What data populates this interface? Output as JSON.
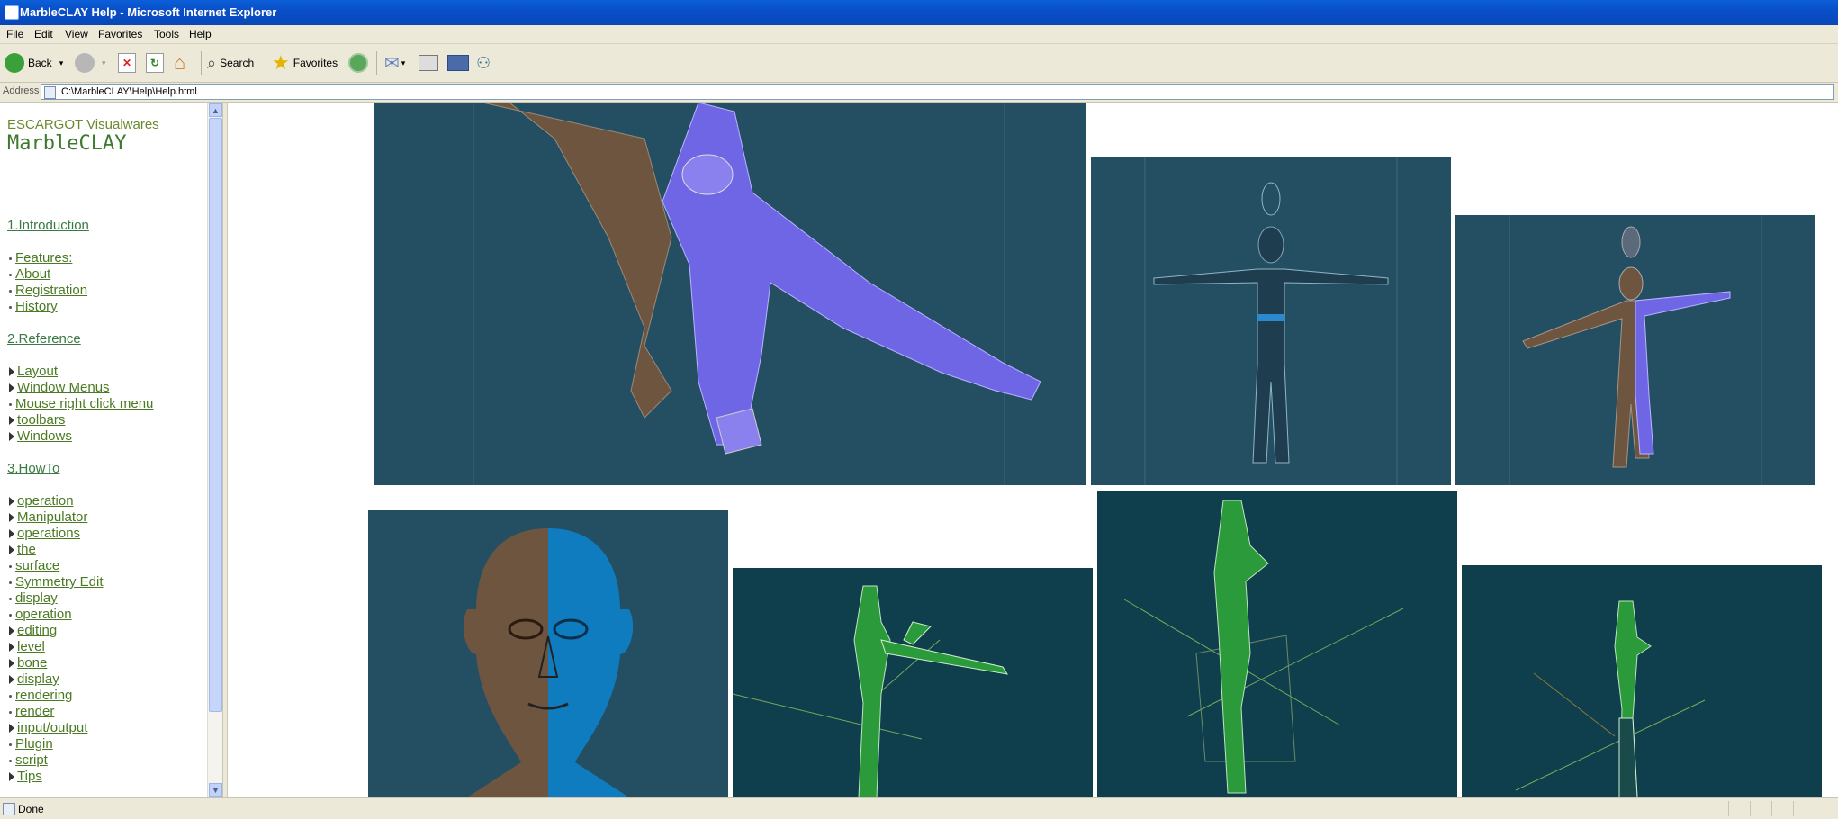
{
  "window": {
    "title": "MarbleCLAY Help - Microsoft Internet Explorer"
  },
  "menu": [
    "File",
    "Edit",
    "View",
    "Favorites",
    "Tools",
    "Help"
  ],
  "toolbar": {
    "back_label": "Back",
    "search_label": "Search",
    "favorites_label": "Favorites"
  },
  "address": {
    "label": "Address",
    "url": "C:\\MarbleCLAY\\Help\\Help.html"
  },
  "nav": {
    "brand": "ESCARGOT Visualwares",
    "product": "MarbleCLAY",
    "sections": [
      {
        "label": "1.Introduction"
      },
      {
        "label": "2.Reference"
      },
      {
        "label": "3.HowTo"
      }
    ],
    "intro_items": [
      "Features:",
      "About",
      "Registration",
      "History"
    ],
    "reference_items": [
      {
        "label": "Layout",
        "bullet": "triangle"
      },
      {
        "label": "Window Menus",
        "bullet": "triangle"
      },
      {
        "label": "Mouse right click menu",
        "bullet": "dot"
      },
      {
        "label": "toolbars",
        "bullet": "triangle"
      },
      {
        "label": "Windows",
        "bullet": "triangle"
      }
    ],
    "howto_items": [
      {
        "label": "operation",
        "bullet": "triangle"
      },
      {
        "label": "Manipulator",
        "bullet": "triangle"
      },
      {
        "label": "operations",
        "bullet": "triangle"
      },
      {
        "label": "the",
        "bullet": "triangle"
      },
      {
        "label": "surface",
        "bullet": "dot"
      },
      {
        "label": "Symmetry Edit",
        "bullet": "dot"
      },
      {
        "label": "display",
        "bullet": "dot"
      },
      {
        "label": "operation",
        "bullet": "dot"
      },
      {
        "label": "editing",
        "bullet": "triangle"
      },
      {
        "label": "level",
        "bullet": "triangle"
      },
      {
        "label": "bone",
        "bullet": "triangle"
      },
      {
        "label": "display",
        "bullet": "triangle"
      },
      {
        "label": "rendering",
        "bullet": "dot"
      },
      {
        "label": "render",
        "bullet": "dot"
      },
      {
        "label": "input/output",
        "bullet": "triangle"
      },
      {
        "label": "Plugin",
        "bullet": "dot"
      },
      {
        "label": "script",
        "bullet": "dot"
      },
      {
        "label": "Tips",
        "bullet": "triangle"
      }
    ]
  },
  "status": {
    "text": "Done"
  },
  "colors": {
    "title_bar": "#0a4fc8",
    "panel_bg": "#244f63",
    "panel_dark": "#0f3f4c",
    "mesh_blue": "#6f66e6",
    "mesh_brown": "#6e5540",
    "mesh_green": "#2b9a3a",
    "nav_link": "#4a7a22"
  }
}
